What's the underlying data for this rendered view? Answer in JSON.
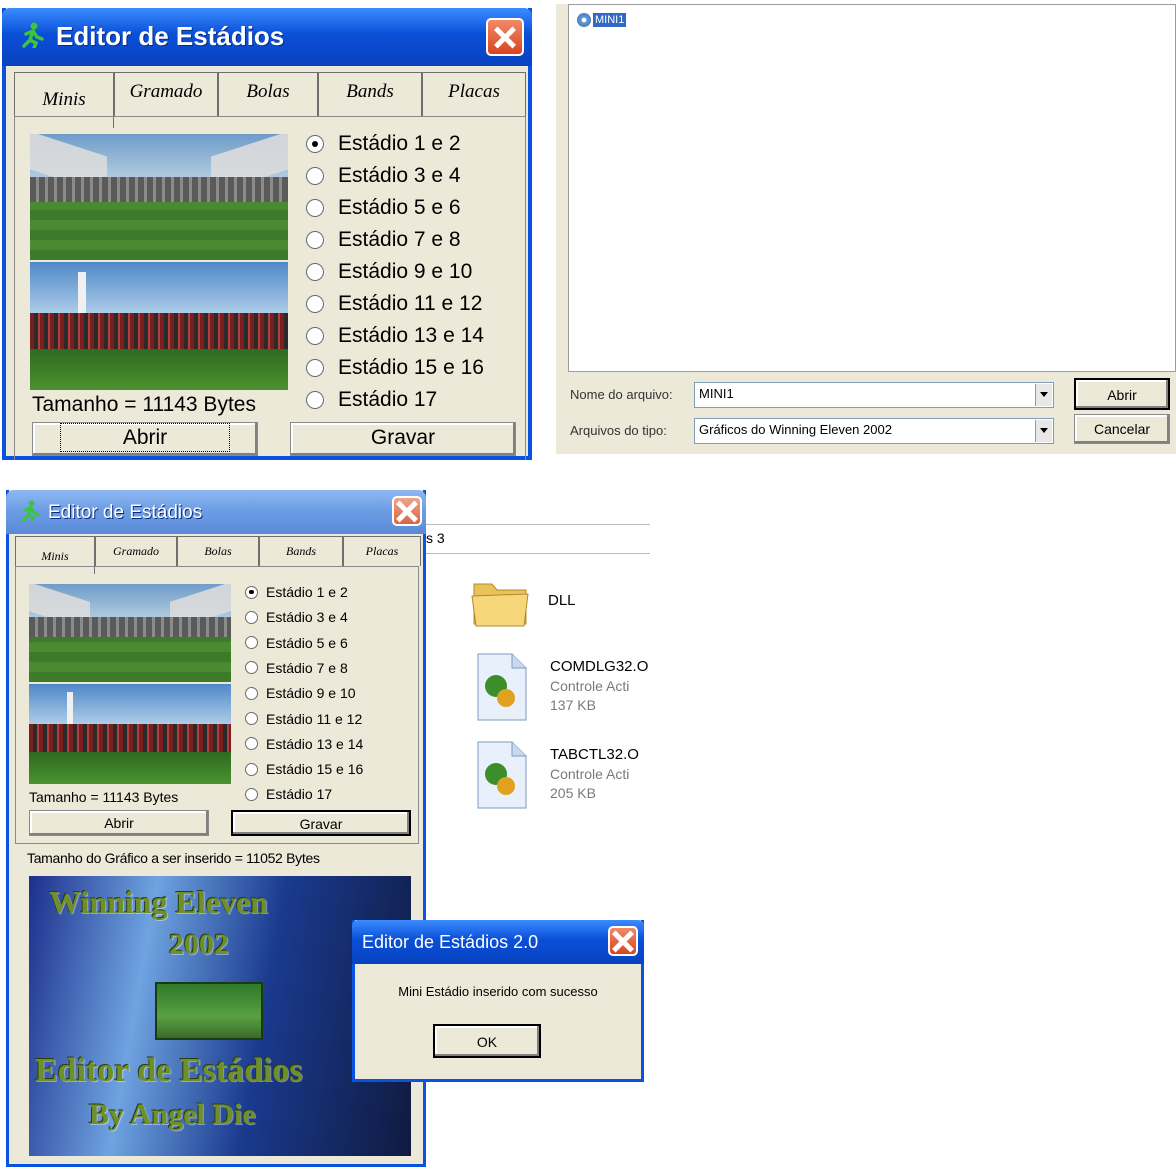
{
  "dialog_top": {
    "title": "Editor de Estádios",
    "tabs": [
      "Minis",
      "Gramado",
      "Bolas",
      "Bands",
      "Placas"
    ],
    "active_tab": "Minis",
    "radios": [
      "Estádio 1 e 2",
      "Estádio 3 e 4",
      "Estádio 5 e 6",
      "Estádio 7 e 8",
      "Estádio 9 e 10",
      "Estádio 11 e 12",
      "Estádio 13 e 14",
      "Estádio 15 e 16",
      "Estádio 17"
    ],
    "selected_radio": "Estádio 1 e 2",
    "size_text": "Tamanho = 11143 Bytes",
    "open_label": "Abrir",
    "save_label": "Gravar"
  },
  "file_dialog": {
    "item_label": "MINI1",
    "filename_label": "Nome do arquivo:",
    "filename_value": "MINI1",
    "filetype_label": "Arquivos do tipo:",
    "filetype_value": "Gráficos do Winning Eleven 2002",
    "open_label": "Abrir",
    "cancel_label": "Cancelar"
  },
  "dialog_bottom": {
    "title": "Editor de Estádios",
    "tabs": [
      "Minis",
      "Gramado",
      "Bolas",
      "Bands",
      "Placas"
    ],
    "radios": [
      "Estádio 1 e 2",
      "Estádio 3 e 4",
      "Estádio 5 e 6",
      "Estádio 7 e 8",
      "Estádio 9 e 10",
      "Estádio 11 e 12",
      "Estádio 13 e 14",
      "Estádio 15 e 16",
      "Estádio 17"
    ],
    "size_text": "Tamanho = 11143 Bytes",
    "open_label": "Abrir",
    "save_label": "Gravar",
    "insert_size_text": "Tamanho do Gráfico a ser inserido = 11052 Bytes",
    "splash_lines": [
      "Winning Eleven",
      "2002",
      "Editor de Estádios",
      "By Angel Die"
    ]
  },
  "explorer": {
    "path_fragment": "s 3",
    "items": [
      {
        "name": "DLL",
        "type": "",
        "size": "",
        "icon": "folder-icon"
      },
      {
        "name": "COMDLG32.O",
        "type": "Controle Acti",
        "size": "137 KB",
        "icon": "activex-file-icon"
      },
      {
        "name": "TABCTL32.O",
        "type": "Controle Acti",
        "size": "205 KB",
        "icon": "activex-file-icon"
      }
    ]
  },
  "message_box": {
    "title": "Editor de Estádios 2.0",
    "message": "Mini Estádio inserido com sucesso",
    "ok_label": "OK"
  },
  "colors": {
    "xp_title_blue": "#0a52e0",
    "xp_face": "#ece9d8",
    "close_red": "#d9451f",
    "selection_blue": "#316ac5"
  }
}
